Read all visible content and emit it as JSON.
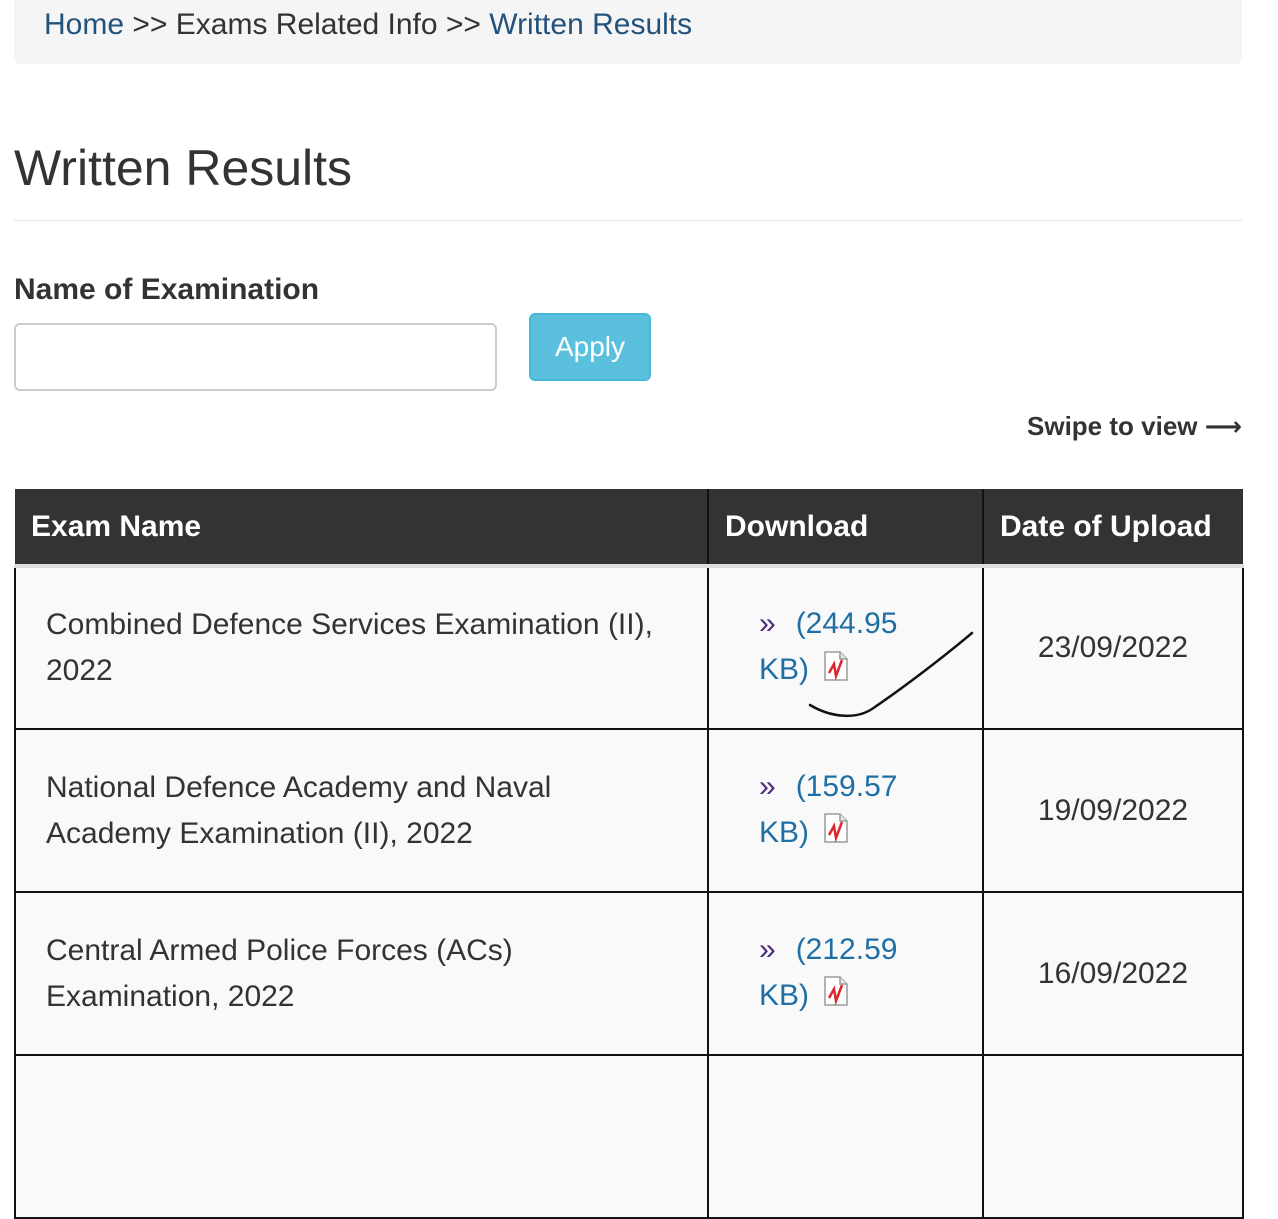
{
  "breadcrumb": {
    "home": "Home",
    "sep1": ">>",
    "middle": "Exams Related Info",
    "sep2": ">>",
    "current": "Written Results"
  },
  "page_title": "Written Results",
  "filter": {
    "label": "Name of Examination",
    "value": "",
    "apply_label": "Apply"
  },
  "swipe_hint": "Swipe to view ⟶",
  "table": {
    "headers": [
      "Exam Name",
      "Download",
      "Date of Upload"
    ],
    "rows": [
      {
        "exam_line1": "Combined Defence Services Examination (II),",
        "exam_line2": "2022",
        "raquo": "»",
        "size_line1": "(244.95",
        "size_line2": "KB)",
        "date": "23/09/2022"
      },
      {
        "exam_line1": "National Defence Academy and Naval",
        "exam_line2": "Academy Examination (II), 2022",
        "raquo": "»",
        "size_line1": "(159.57",
        "size_line2": "KB)",
        "date": "19/09/2022"
      },
      {
        "exam_line1": "Central Armed Police Forces (ACs)",
        "exam_line2": "Examination, 2022",
        "raquo": "»",
        "size_line1": "(212.59",
        "size_line2": "KB)",
        "date": "16/09/2022"
      },
      {
        "exam_line1": "",
        "exam_line2": "",
        "raquo": "",
        "size_line1": "",
        "size_line2": "",
        "date": ""
      }
    ]
  },
  "colors": {
    "link": "#23527c",
    "header_bg": "#333333",
    "apply_bg": "#5bc0de",
    "pdf_red": "#d9282f"
  },
  "icons": {
    "pdf": "pdf-file-icon",
    "annotation": "hand-drawn-tick-mark"
  }
}
